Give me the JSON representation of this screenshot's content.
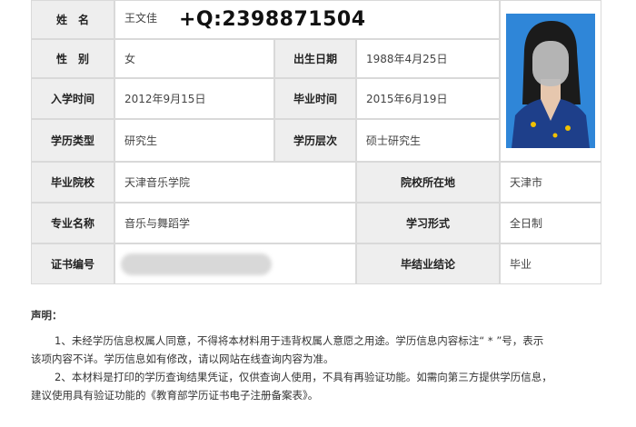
{
  "table": {
    "name": {
      "label": "姓　名",
      "value": "王文佳"
    },
    "gender": {
      "label": "性　别",
      "value": "女"
    },
    "birth": {
      "label": "出生日期",
      "value": "1988年4月25日"
    },
    "enroll": {
      "label": "入学时间",
      "value": "2012年9月15日"
    },
    "graduate": {
      "label": "毕业时间",
      "value": "2015年6月19日"
    },
    "degree_type": {
      "label": "学历类型",
      "value": "研究生"
    },
    "degree_level": {
      "label": "学历层次",
      "value": "硕士研究生"
    },
    "school": {
      "label": "毕业院校",
      "value": "天津音乐学院"
    },
    "school_location": {
      "label": "院校所在地",
      "value": "天津市"
    },
    "major": {
      "label": "专业名称",
      "value": "音乐与舞蹈学"
    },
    "study_mode": {
      "label": "学习形式",
      "value": "全日制"
    },
    "cert_no": {
      "label": "证书编号",
      "value": ""
    },
    "conclusion": {
      "label": "毕结业结论",
      "value": "毕业"
    }
  },
  "watermark": "+Q:2398871504",
  "declaration": {
    "title": "声明：",
    "p1_line1": "1、未经学历信息权属人同意，不得将本材料用于违背权属人意愿之用途。学历信息内容标注“ * ”号，表示",
    "p1_line2": "该项内容不详。学历信息如有修改，请以网站在线查询内容为准。",
    "p2_line1": "2、本材料是打印的学历查询结果凭证，仅供查询人使用，不具有再验证功能。如需向第三方提供学历信息，",
    "p2_line2": "建议使用具有验证功能的《教育部学历证书电子注册备案表》。"
  }
}
